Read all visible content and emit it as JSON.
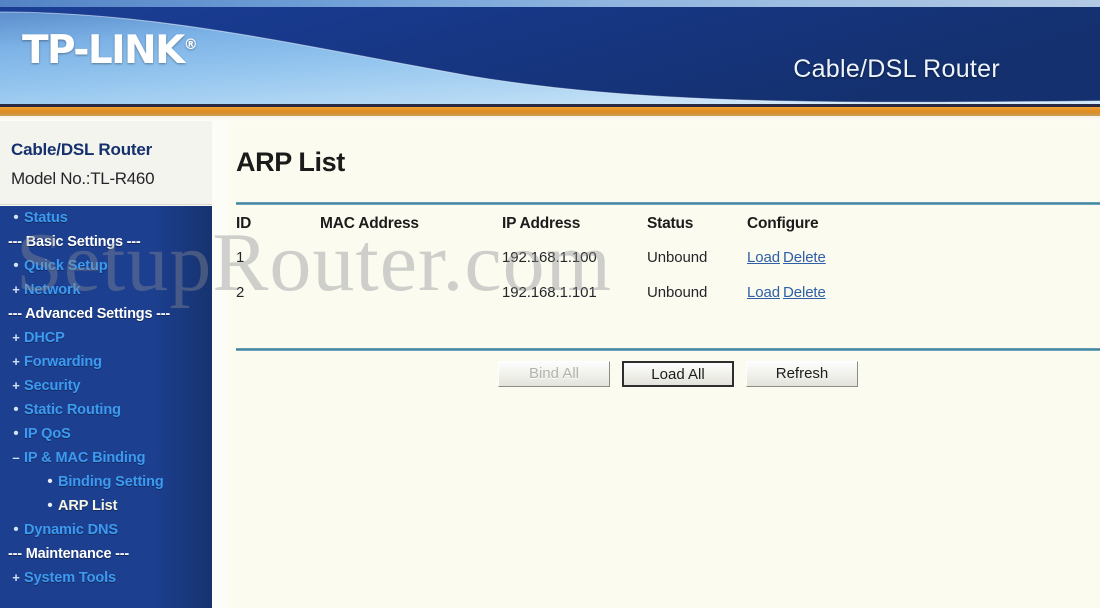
{
  "banner": {
    "logo_text": "TP-LINK",
    "logo_trademark": "®",
    "subtitle": "Cable/DSL Router",
    "bg_dark_blue": "#17398c",
    "bg_light_blue": "#8ec4ea",
    "accent_orange": "#dd8c22"
  },
  "sidebar": {
    "title": "Cable/DSL Router",
    "model": "Model No.:TL-R460",
    "link_color": "#3c9bf0",
    "active_color": "#f7f7e4",
    "bg_color": "#1c3f8f",
    "items": [
      {
        "type": "link",
        "marker": "•",
        "label": "Status",
        "level": 1,
        "active": false
      },
      {
        "type": "section",
        "marker": "",
        "label": "--- Basic Settings ---",
        "level": 1,
        "active": false
      },
      {
        "type": "link",
        "marker": "•",
        "label": "Quick Setup",
        "level": 1,
        "active": false
      },
      {
        "type": "link",
        "marker": "+",
        "label": "Network",
        "level": 1,
        "active": false
      },
      {
        "type": "section",
        "marker": "",
        "label": "--- Advanced Settings ---",
        "level": 1,
        "active": false
      },
      {
        "type": "link",
        "marker": "+",
        "label": "DHCP",
        "level": 1,
        "active": false
      },
      {
        "type": "link",
        "marker": "+",
        "label": "Forwarding",
        "level": 1,
        "active": false
      },
      {
        "type": "link",
        "marker": "+",
        "label": "Security",
        "level": 1,
        "active": false
      },
      {
        "type": "link",
        "marker": "•",
        "label": "Static Routing",
        "level": 1,
        "active": false
      },
      {
        "type": "link",
        "marker": "•",
        "label": "IP QoS",
        "level": 1,
        "active": false
      },
      {
        "type": "link",
        "marker": "–",
        "label": "IP & MAC Binding",
        "level": 1,
        "active": false
      },
      {
        "type": "link",
        "marker": "•",
        "label": "Binding Setting",
        "level": 2,
        "active": false
      },
      {
        "type": "link",
        "marker": "•",
        "label": "ARP List",
        "level": 2,
        "active": true
      },
      {
        "type": "link",
        "marker": "•",
        "label": "Dynamic DNS",
        "level": 1,
        "active": false
      },
      {
        "type": "section",
        "marker": "",
        "label": "--- Maintenance ---",
        "level": 1,
        "active": false
      },
      {
        "type": "link",
        "marker": "+",
        "label": "System Tools",
        "level": 1,
        "active": false
      }
    ]
  },
  "main": {
    "page_title": "ARP List",
    "table": {
      "columns": [
        "ID",
        "MAC Address",
        "IP Address",
        "Status",
        "Configure"
      ],
      "rows": [
        {
          "id": "1",
          "mac": "",
          "ip": "192.168.1.100",
          "status": "Unbound",
          "load": "Load",
          "delete": "Delete"
        },
        {
          "id": "2",
          "mac": "",
          "ip": "192.168.1.101",
          "status": "Unbound",
          "load": "Load",
          "delete": "Delete"
        }
      ]
    },
    "buttons": [
      {
        "label": "Bind All",
        "state": "disabled"
      },
      {
        "label": "Load All",
        "state": "focused"
      },
      {
        "label": "Refresh",
        "state": "normal"
      }
    ],
    "rule_color": "#3f7f9b",
    "link_color": "#2f5fa6"
  },
  "watermark": {
    "text": "SetupRouter.com"
  }
}
